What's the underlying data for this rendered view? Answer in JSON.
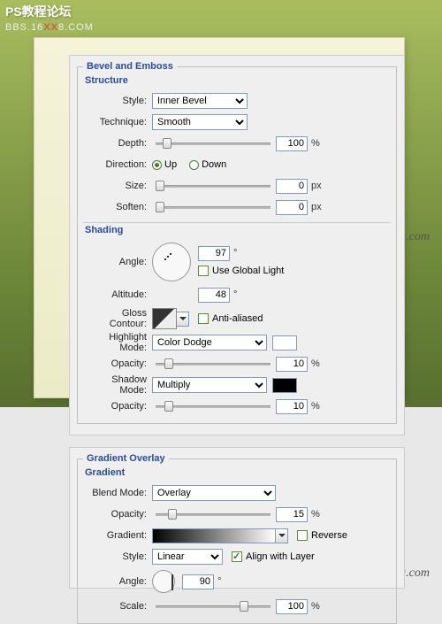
{
  "watermark": {
    "line1": "PS教程论坛",
    "line2a": "BBS.16",
    "line2b": "XX",
    "line2c": "8.COM",
    "suda": "sudasuta.com"
  },
  "bevel": {
    "group_title": "Bevel and Emboss",
    "structure_title": "Structure",
    "style_label": "Style:",
    "style_value": "Inner Bevel",
    "technique_label": "Technique:",
    "technique_value": "Smooth",
    "depth_label": "Depth:",
    "depth_value": "100",
    "depth_unit": "%",
    "direction_label": "Direction:",
    "up": "Up",
    "down": "Down",
    "size_label": "Size:",
    "size_value": "0",
    "size_unit": "px",
    "soften_label": "Soften:",
    "soften_value": "0",
    "soften_unit": "px",
    "shading_title": "Shading",
    "angle_label": "Angle:",
    "angle_value": "97",
    "deg": "°",
    "global_label": "Use Global Light",
    "altitude_label": "Altitude:",
    "altitude_value": "48",
    "gloss_label": "Gloss Contour:",
    "anti_label": "Anti-aliased",
    "highlight_label": "Highlight Mode:",
    "highlight_value": "Color Dodge",
    "opacity_label": "Opacity:",
    "hi_opacity": "10",
    "shadow_label": "Shadow Mode:",
    "shadow_value": "Multiply",
    "sh_opacity": "10",
    "pct": "%"
  },
  "go": {
    "group_title": "Gradient Overlay",
    "gradient_title": "Gradient",
    "blend_label": "Blend Mode:",
    "blend_value": "Overlay",
    "opacity_label": "Opacity:",
    "opacity_value": "15",
    "pct": "%",
    "gradient_label": "Gradient:",
    "reverse": "Reverse",
    "style_label": "Style:",
    "style_value": "Linear",
    "align": "Align with Layer",
    "angle_label": "Angle:",
    "angle_value": "90",
    "deg": "°",
    "scale_label": "Scale:",
    "scale_value": "100"
  }
}
